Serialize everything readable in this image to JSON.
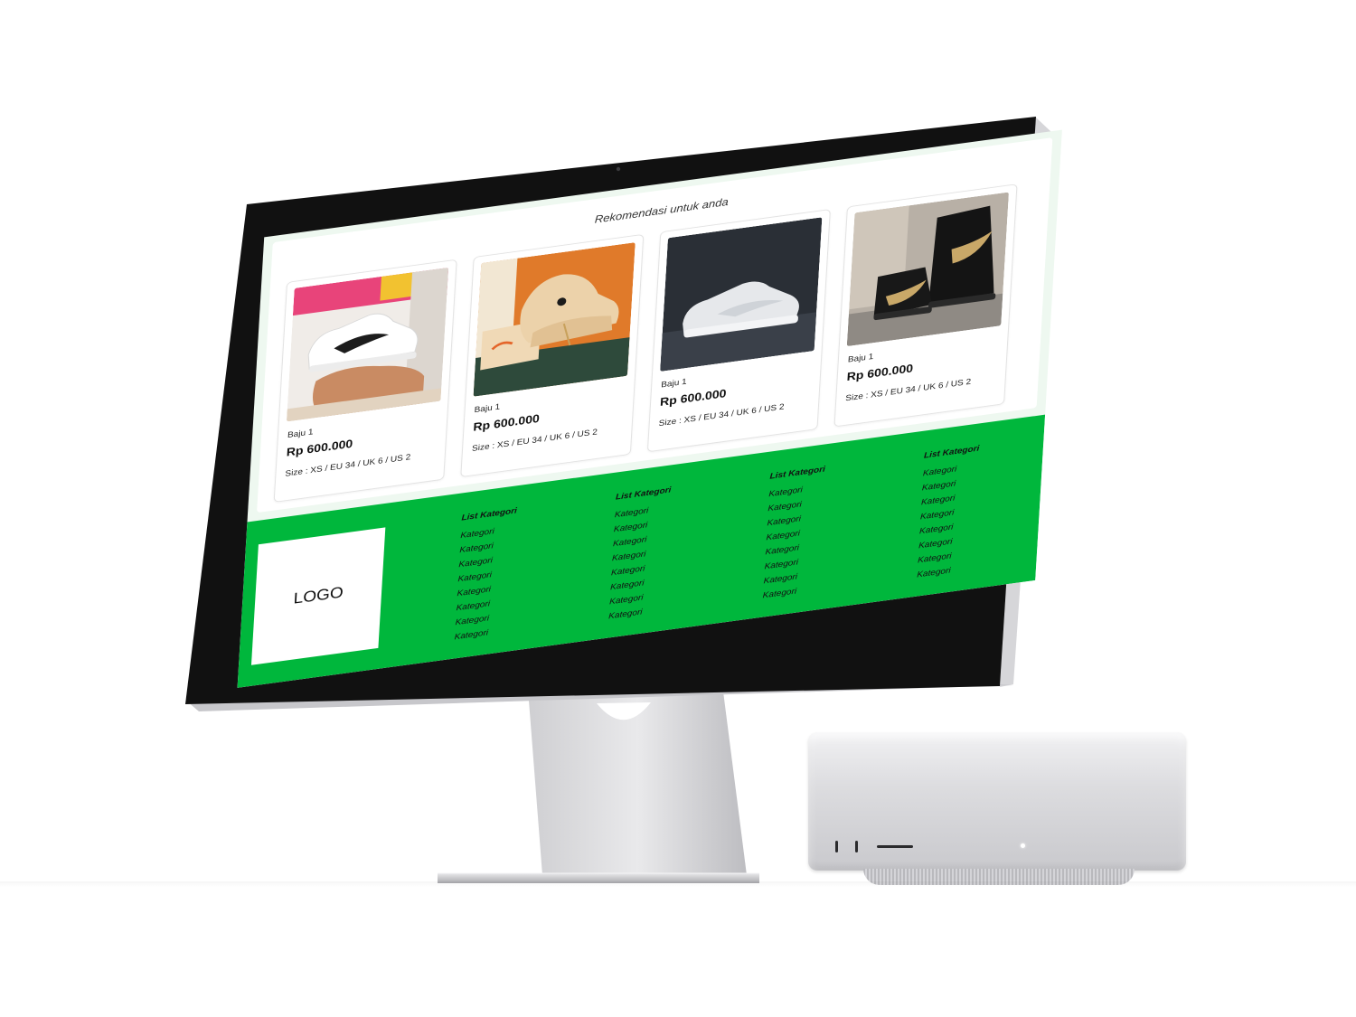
{
  "recommendations": {
    "title": "Rekomendasi untuk anda",
    "cards": [
      {
        "name": "Baju 1",
        "price": "Rp 600.000",
        "size": "Size : XS / EU 34 / UK 6 / US 2",
        "image": "white-sneaker-held-in-hand"
      },
      {
        "name": "Baju 1",
        "price": "Rp 600.000",
        "size": "Size : XS / EU 34 / UK 6 / US 2",
        "image": "cream-sneakers-on-orange-box"
      },
      {
        "name": "Baju 1",
        "price": "Rp 600.000",
        "size": "Size : XS / EU 34 / UK 6 / US 2",
        "image": "white-sneaker-dark-background"
      },
      {
        "name": "Baju 1",
        "price": "Rp 600.000",
        "size": "Size : XS / EU 34 / UK 6 / US 2",
        "image": "black-gold-high-top-sneakers"
      }
    ]
  },
  "footer": {
    "logo": "LOGO",
    "columns": [
      {
        "heading": "List Kategori",
        "items": [
          "Kategori",
          "Kategori",
          "Kategori",
          "Kategori",
          "Kategori",
          "Kategori",
          "Kategori",
          "Kategori"
        ]
      },
      {
        "heading": "List Kategori",
        "items": [
          "Kategori",
          "Kategori",
          "Kategori",
          "Kategori",
          "Kategori",
          "Kategori",
          "Kategori",
          "Kategori"
        ]
      },
      {
        "heading": "List Kategori",
        "items": [
          "Kategori",
          "Kategori",
          "Kategori",
          "Kategori",
          "Kategori",
          "Kategori",
          "Kategori",
          "Kategori"
        ]
      },
      {
        "heading": "List Kategori",
        "items": [
          "Kategori",
          "Kategori",
          "Kategori",
          "Kategori",
          "Kategori",
          "Kategori",
          "Kategori",
          "Kategori"
        ]
      }
    ]
  },
  "colors": {
    "footer_green": "#00b73c",
    "page_tint": "#eef8f0",
    "bezel": "#111111",
    "aluminum": "#d9d9dc"
  }
}
